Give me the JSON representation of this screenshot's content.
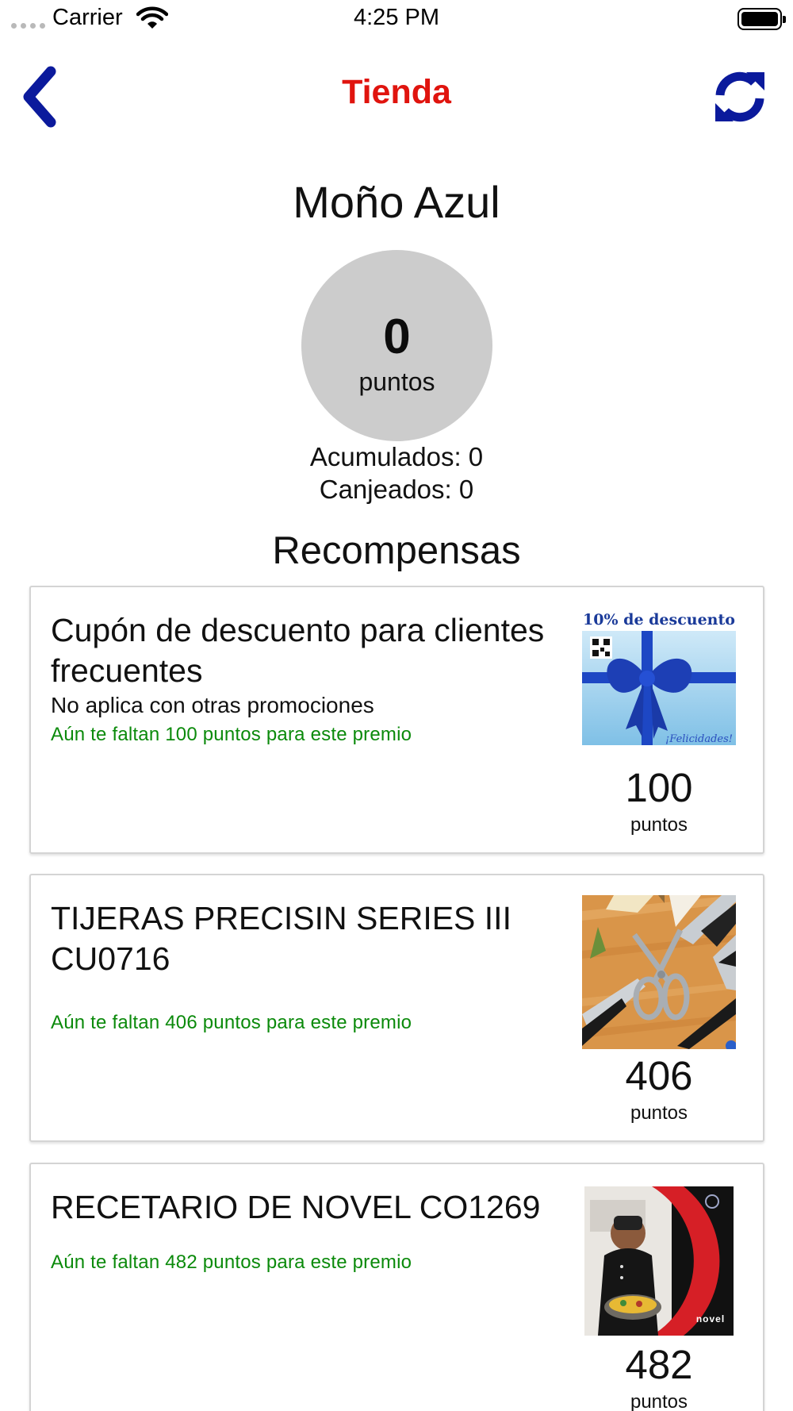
{
  "status_bar": {
    "carrier": "Carrier",
    "time": "4:25 PM"
  },
  "nav": {
    "title": "Tienda",
    "back_icon": "chevron-left-icon",
    "refresh_icon": "refresh-icon",
    "accent_color": "#0b1a9c",
    "title_color": "#e0140e"
  },
  "store": {
    "name": "Moño Azul",
    "points": "0",
    "points_unit": "puntos",
    "accumulated": "Acumulados: 0",
    "redeemed": "Canjeados: 0"
  },
  "rewards_section": {
    "title": "Recompensas",
    "items": [
      {
        "title": "Cupón de descuento para clientes frecuentes",
        "description": "No aplica con otras promociones",
        "missing": "Aún te faltan 100 puntos para este premio",
        "points": "100",
        "points_unit": "puntos",
        "image": {
          "banner_text": "10% de descuento",
          "footer_text": "¡Felicidades!"
        }
      },
      {
        "title": "TIJERAS PRECISIN SERIES III CU0716",
        "description": "",
        "missing": "Aún te faltan 406 puntos para este premio",
        "points": "406",
        "points_unit": "puntos",
        "image": {}
      },
      {
        "title": "RECETARIO DE NOVEL CO1269",
        "description": "",
        "missing": "Aún te faltan 482 puntos para este premio",
        "points": "482",
        "points_unit": "puntos",
        "image": {
          "brand_text": "novel"
        }
      }
    ]
  }
}
